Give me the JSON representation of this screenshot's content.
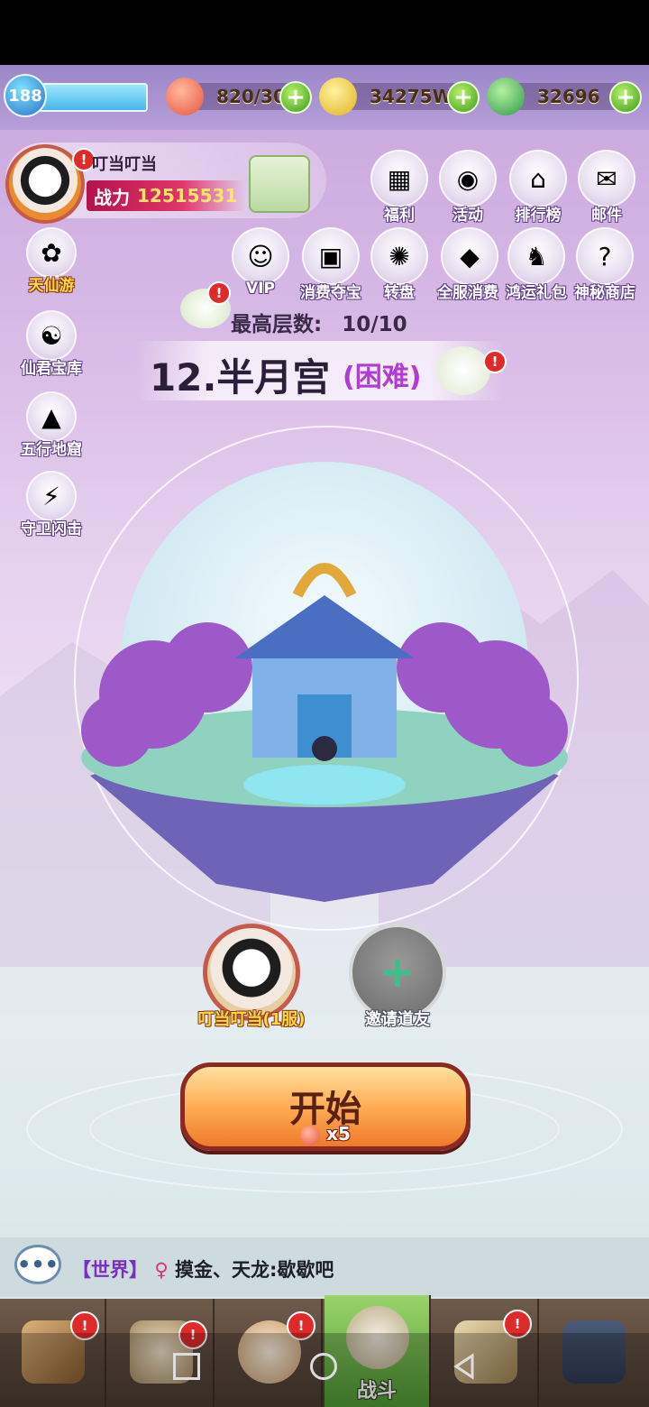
{
  "hud": {
    "level": "188",
    "peach": "820/30",
    "coins": "34275W",
    "jade": "32696"
  },
  "profile": {
    "name": "叮当叮当",
    "power_label": "战力",
    "power_value": "12515531"
  },
  "top_icons": [
    {
      "label": "福利",
      "icon": "gift-calendar-icon"
    },
    {
      "label": "活动",
      "icon": "drum-icon"
    },
    {
      "label": "排行榜",
      "icon": "pavilion-icon"
    },
    {
      "label": "邮件",
      "icon": "mail-gate-icon"
    }
  ],
  "second_icons": [
    {
      "label": "VIP",
      "icon": "vip-icon"
    },
    {
      "label": "消费夺宝",
      "icon": "treasure-chest-icon"
    },
    {
      "label": "转盘",
      "icon": "wheel-icon"
    },
    {
      "label": "全服消费",
      "icon": "jewel-icon"
    },
    {
      "label": "鸿运礼包",
      "icon": "dragon-icon"
    },
    {
      "label": "神秘商店",
      "icon": "mystery-peach-icon"
    }
  ],
  "left_icons": [
    {
      "label": "天仙游"
    },
    {
      "label": "仙君宝库"
    },
    {
      "label": "五行地窟"
    },
    {
      "label": "守卫闪击"
    }
  ],
  "stage": {
    "max_floor_label": "最高层数:",
    "max_floor_value": "10/10",
    "name": "12.半月宫",
    "difficulty": "(困难)"
  },
  "team": {
    "member1": "叮当叮当(1服)",
    "invite": "邀请道友"
  },
  "start": {
    "label": "开始",
    "cost": "x5"
  },
  "chat": {
    "channel": "【世界】",
    "gender": "♀",
    "message": "摸金、天龙:歇歇吧"
  },
  "nav": {
    "battle": "战斗"
  },
  "colors": {
    "accent_red": "#e02a2a",
    "start_orange": "#f07a2a",
    "plus_green": "#3e9a1e"
  }
}
